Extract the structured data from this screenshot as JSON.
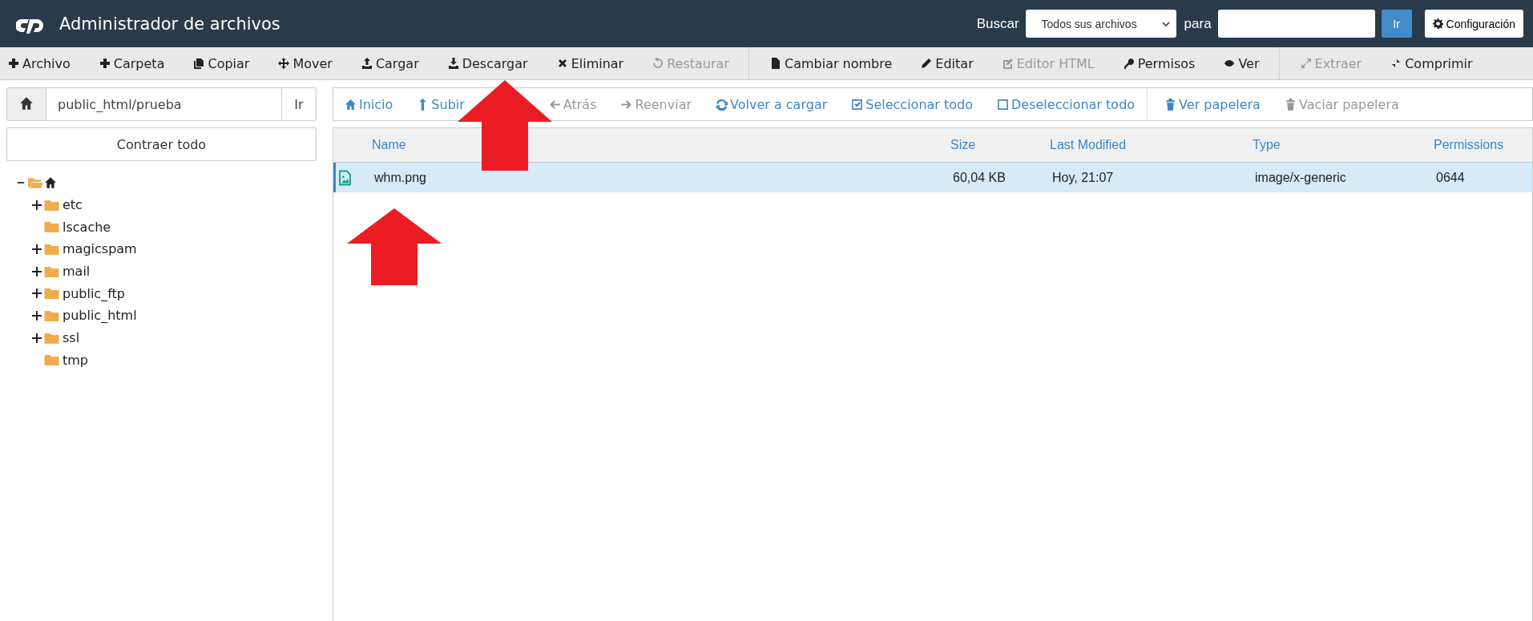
{
  "header": {
    "title": "Administrador de archivos",
    "search_label": "Buscar",
    "search_scope": "Todos sus archivos",
    "for_label": "para",
    "go_button": "Ir",
    "settings_button": "Configuración"
  },
  "toolbar": [
    [
      {
        "label": "Archivo",
        "disabled": false
      },
      {
        "label": "Carpeta",
        "disabled": false
      },
      {
        "label": "Copiar",
        "disabled": false
      },
      {
        "label": "Mover",
        "disabled": false
      },
      {
        "label": "Cargar",
        "disabled": false
      },
      {
        "label": "Descargar",
        "disabled": false
      },
      {
        "label": "Eliminar",
        "disabled": false
      },
      {
        "label": "Restaurar",
        "disabled": true
      }
    ],
    [
      {
        "label": "Cambiar nombre",
        "disabled": false
      },
      {
        "label": "Editar",
        "disabled": false
      },
      {
        "label": "Editor HTML",
        "disabled": true
      },
      {
        "label": "Permisos",
        "disabled": false
      },
      {
        "label": "Ver",
        "disabled": false
      }
    ],
    [
      {
        "label": "Extraer",
        "disabled": true
      },
      {
        "label": "Comprimir",
        "disabled": false
      }
    ]
  ],
  "path_bar": {
    "value": "public_html/prueba",
    "go_button": "Ir"
  },
  "collapse_button": "Contraer todo",
  "tree": {
    "expanded": true,
    "children": [
      {
        "label": "etc",
        "expandable": true
      },
      {
        "label": "lscache",
        "expandable": false
      },
      {
        "label": "magicspam",
        "expandable": true
      },
      {
        "label": "mail",
        "expandable": true
      },
      {
        "label": "public_ftp",
        "expandable": true
      },
      {
        "label": "public_html",
        "expandable": true
      },
      {
        "label": "ssl",
        "expandable": true
      },
      {
        "label": "tmp",
        "expandable": false
      }
    ]
  },
  "nav": [
    [
      {
        "label": "Inicio",
        "disabled": false
      },
      {
        "label": "Subir",
        "disabled": false
      },
      {
        "label": "Atrás",
        "disabled": true
      },
      {
        "label": "Reenviar",
        "disabled": true
      },
      {
        "label": "Volver a cargar",
        "disabled": false
      },
      {
        "label": "Seleccionar todo",
        "disabled": false
      },
      {
        "label": "Deseleccionar todo",
        "disabled": false
      }
    ],
    [
      {
        "label": "Ver papelera",
        "disabled": false
      },
      {
        "label": "Vaciar papelera",
        "disabled": true
      }
    ]
  ],
  "table": {
    "columns": [
      "Name",
      "Size",
      "Last Modified",
      "Type",
      "Permissions"
    ],
    "rows": [
      {
        "selected": true,
        "cells": [
          "whm.png",
          "60,04 KB",
          "Hoy, 21:07",
          "image/x-generic",
          "0644"
        ]
      }
    ]
  }
}
